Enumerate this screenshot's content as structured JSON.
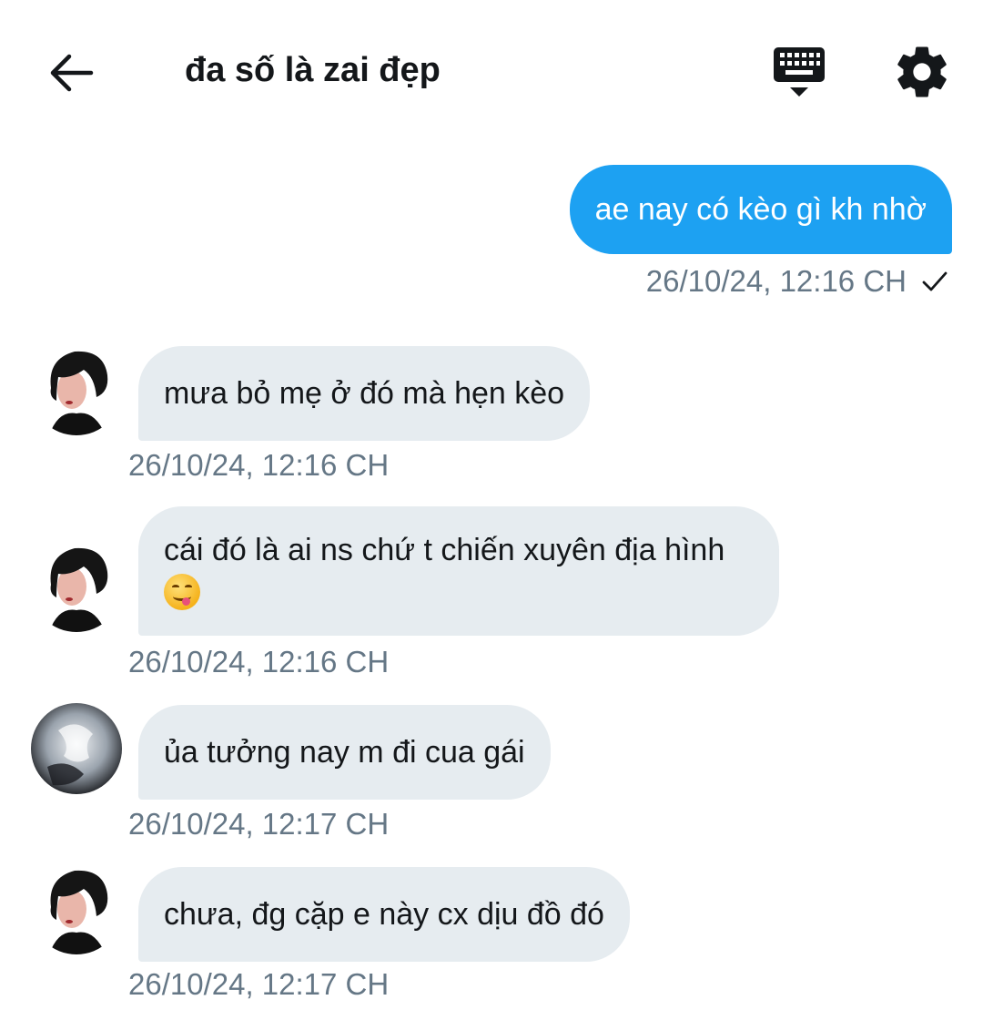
{
  "header": {
    "title": "đa số là zai đẹp",
    "back_icon": "arrow-left-icon",
    "keyboard_icon": "keyboard-icon",
    "settings_icon": "gear-icon"
  },
  "colors": {
    "outgoing_bubble": "#1da1f2",
    "incoming_bubble": "#e6ecf0",
    "timestamp": "#657786"
  },
  "messages": [
    {
      "direction": "outgoing",
      "text": "ae nay có kèo gì kh nhờ",
      "time": "26/10/24, 12:16 CH",
      "status_icon": "check-icon"
    },
    {
      "direction": "incoming",
      "sender_avatar": "avatar-dark-hair",
      "text": "mưa bỏ mẹ ở đó mà hẹn kèo",
      "time": "26/10/24, 12:16 CH"
    },
    {
      "direction": "incoming",
      "sender_avatar": "avatar-dark-hair",
      "text": "cái đó là ai ns chứ t chiến xuyên địa hình",
      "emoji": "face-savoring-food-emoji",
      "time": "26/10/24, 12:16 CH"
    },
    {
      "direction": "incoming",
      "sender_avatar": "avatar-smoke",
      "text": "ủa tưởng nay m đi cua gái",
      "time": "26/10/24, 12:17 CH"
    },
    {
      "direction": "incoming",
      "sender_avatar": "avatar-dark-hair",
      "text": "chưa, đg cặp e này cx dịu đồ đó",
      "time": "26/10/24, 12:17 CH"
    }
  ]
}
